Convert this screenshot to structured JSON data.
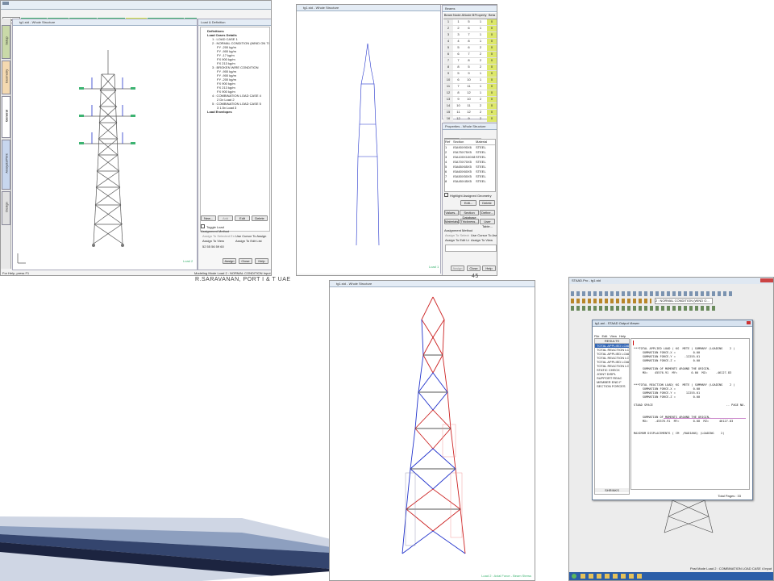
{
  "slide": {
    "footer_author": "R.SARAVANAN, PORT I & T UAE",
    "page_number": "45"
  },
  "shot1": {
    "menu_tabs": [
      "Modeling",
      "Postprocessing",
      "Steel Design",
      "Concrete Design",
      "RAM Connection",
      "Bridge Deck",
      "Advanced Slab Design",
      "Piping"
    ],
    "side_tabs": [
      "Setup",
      "Geometry",
      "General",
      "Analysis/Print",
      "Design"
    ],
    "whole_view_title": "tg1.std - Whole Structure",
    "load_panel_title": "Load & Definition",
    "tree": [
      "Definitions",
      "Load Cases Details",
      "1 : LOAD CASE 1",
      "2 : NORMAL CONDITION (WIND ON TOWER)",
      "FY -200 kg/m",
      "FY -900 kg/m",
      "FY -17 kg/m",
      "FX 900 kg/m",
      "FX 213 kg/m",
      "3 : BROKEN WIRE CONDITION",
      "FY -900 kg/m",
      "FY -900 kg/m",
      "FY -200 kg/m",
      "FX 900 kg/m",
      "FX 213 kg/m",
      "FX 900 kg/m",
      "4 : COMBINATION LOAD CASE 4",
      "2 Dx Load 2",
      "5 : COMBINATION LOAD CASE 5",
      "3 1.5x Load 3",
      "Load Envelopes"
    ],
    "buttons": {
      "new": "New...",
      "add": "Add",
      "edit": "Edit",
      "delete": "Delete",
      "assign": "Assign",
      "close": "Close",
      "help": "Help"
    },
    "toggle_load": "Toggle Load",
    "assign_method": "Assignment Method",
    "assign_options": [
      "Assign To Selected Entities",
      "Use Cursor To Assign",
      "Assign To View",
      "Assign To Edit List"
    ],
    "selection_text": "52 55 56 59 60",
    "load_unit": "Load 2",
    "status_left": "For Help, press F1",
    "status_right": "Modeling Mode  Load 2 : NORMAL CONDITION  Input Units : kg-m"
  },
  "shot2": {
    "title": "tg1.std - Whole Structure",
    "table_title": "Beams",
    "table_headers": [
      "Beam",
      "Node A",
      "Node B",
      "Property",
      "Beta"
    ],
    "table_rows": [
      [
        "1",
        "1",
        "5",
        "1",
        "0"
      ],
      [
        "2",
        "2",
        "6",
        "1",
        "0"
      ],
      [
        "3",
        "3",
        "7",
        "1",
        "0"
      ],
      [
        "4",
        "4",
        "8",
        "1",
        "0"
      ],
      [
        "5",
        "5",
        "6",
        "2",
        "0"
      ],
      [
        "6",
        "6",
        "7",
        "2",
        "0"
      ],
      [
        "7",
        "7",
        "8",
        "2",
        "0"
      ],
      [
        "8",
        "8",
        "5",
        "2",
        "0"
      ],
      [
        "9",
        "5",
        "9",
        "1",
        "0"
      ],
      [
        "10",
        "6",
        "10",
        "1",
        "0"
      ],
      [
        "11",
        "7",
        "11",
        "1",
        "0"
      ],
      [
        "12",
        "8",
        "12",
        "1",
        "0"
      ],
      [
        "13",
        "9",
        "10",
        "2",
        "0"
      ],
      [
        "14",
        "10",
        "11",
        "2",
        "0"
      ],
      [
        "15",
        "11",
        "12",
        "2",
        "0"
      ],
      [
        "16",
        "12",
        "9",
        "2",
        "0"
      ]
    ],
    "props_title": "Properties - Whole Structure",
    "props_tabs": [
      "Section",
      "Beta Angle"
    ],
    "props_headers": [
      "Ref",
      "Section",
      "Material"
    ],
    "props_rows": [
      [
        "1",
        "ISA90X90X6",
        "STEEL"
      ],
      [
        "2",
        "ISA75X75X5",
        "STEEL"
      ],
      [
        "3",
        "ISA100X100X8",
        "STEEL"
      ],
      [
        "4",
        "ISA70X70X5",
        "STEEL"
      ],
      [
        "5",
        "ISA65X65X5",
        "STEEL"
      ],
      [
        "6",
        "ISA60X60X5",
        "STEEL"
      ],
      [
        "7",
        "ISA50X50X5",
        "STEEL"
      ],
      [
        "8",
        "ISA45X45X5",
        "STEEL"
      ]
    ],
    "highlight": "Highlight Assigned Geometry",
    "buttons": {
      "edit": "Edit...",
      "delete": "Delete",
      "values": "Values...",
      "section_db": "Section Database",
      "define": "Define...",
      "materials": "Materials...",
      "thickness": "Thickness...",
      "user_table": "User Table...",
      "assign": "Assign",
      "close": "Close",
      "help": "Help"
    },
    "assign_method": "Assignment Method",
    "assign_options": [
      "Assign To Selected Beams",
      "Use Cursor To Assign",
      "Assign To Edit List",
      "Assign To View"
    ],
    "load_label": "Load 1"
  },
  "shot3": {
    "title": "tg1.std - Whole Structure",
    "status": "Load 2 : Axial Force - Beam Stress"
  },
  "shot4": {
    "app_title": "STAAD.Pro - tg1.std",
    "menu": [
      "File",
      "Edit",
      "View",
      "Tools",
      "Select",
      "Geometry",
      "Commands",
      "Analyze",
      "Mode",
      "Window",
      "Help"
    ],
    "load_combo": "2 : NORMAL CONDITION (WIND O...",
    "output_title": "tg1.anl - STAAD Output Viewer",
    "output_menu": [
      "File",
      "Edit",
      "View",
      "Help"
    ],
    "results_header": "RESULTS",
    "results_items": [
      "TOTAL APPLIED LOAD 1",
      "TOTAL REACTION LOAD 1",
      "TOTAL APPLIED LOAD 2",
      "TOTAL REACTION LOAD 2",
      "TOTAL APPLIED LOAD 3",
      "TOTAL REACTION LOAD 3",
      "STATIC CHECK",
      "JOINT DISPL",
      "SUPPORT REAC",
      "MEMBER END F",
      "SECTION FORCES"
    ],
    "output_lines": [
      "***TOTAL APPLIED LOAD ( KG  METE ) SUMMARY (LOADING    2 )",
      "     SUMMATION FORCE-X =          0.00",
      "     SUMMATION FORCE-Y =     -12255.01",
      "     SUMMATION FORCE-Z =          0.00",
      "",
      "     SUMMATION OF MOMENTS AROUND THE ORIGIN-",
      "     MX=    45576.91  MY=        0.00  MZ=     -46127.83",
      "",
      "",
      "***TOTAL REACTION LOAD( KG  METE ) SUMMARY (LOADING    2 )",
      "     SUMMATION FORCE-X =          0.00",
      "     SUMMATION FORCE-Y =      12255.01",
      "     SUMMATION FORCE-Z =          0.00",
      "",
      "STAAD SPACE                                          -- PAGE NO.    7",
      "",
      "",
      "     SUMMATION OF MOMENTS AROUND THE ORIGIN-",
      "     MX=    -45576.91  MY=        0.00  MZ=      46127.83",
      "",
      "",
      "MAXIMUM DISPLACEMENTS ( CM  /RADIANS) (LOADING    2)"
    ],
    "results_footer": "SHRINKS",
    "total_pages": "Total Pages : 33",
    "status": "Post Mode    Load 2 : COMBINATION LOAD CASE 4    Input Units : kg-m"
  },
  "colors": {
    "accent_green": "#3cb371",
    "blue_members": "#2233cc",
    "red_members": "#cc2222",
    "title_bar": "#e4ecf5"
  }
}
